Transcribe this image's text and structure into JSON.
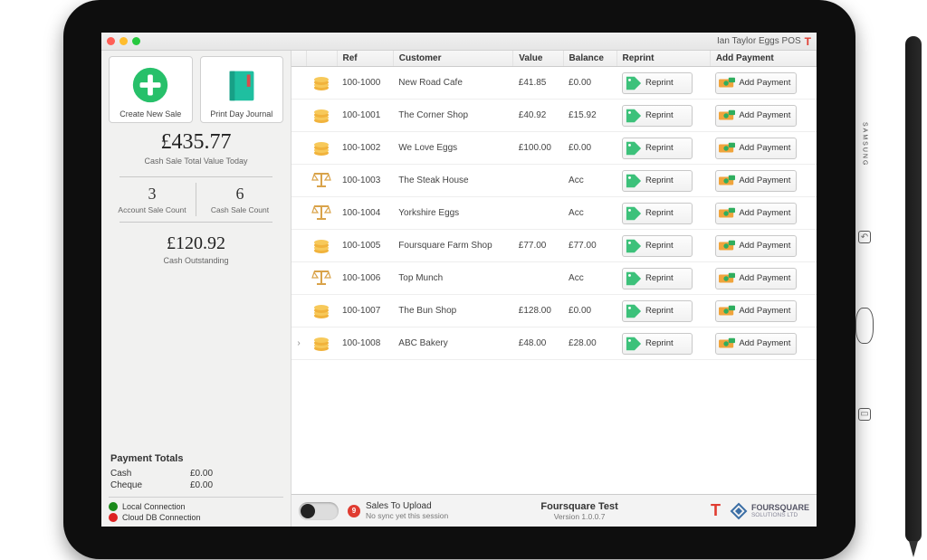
{
  "title": "Ian Taylor Eggs POS",
  "actions": {
    "new_sale": "Create New Sale",
    "print_journal": "Print Day Journal"
  },
  "stats": {
    "cash_total_value": "£435.77",
    "cash_total_label": "Cash Sale Total Value Today",
    "account_sale_count": "3",
    "account_sale_label": "Account Sale Count",
    "cash_sale_count": "6",
    "cash_sale_label": "Cash Sale Count",
    "cash_outstanding": "£120.92",
    "cash_outstanding_label": "Cash Outstanding"
  },
  "payment_totals": {
    "heading": "Payment Totals",
    "cash_label": "Cash",
    "cash_value": "£0.00",
    "cheque_label": "Cheque",
    "cheque_value": "£0.00"
  },
  "connections": {
    "local": "Local Connection",
    "cloud": "Cloud DB Connection"
  },
  "columns": {
    "ref": "Ref",
    "customer": "Customer",
    "value": "Value",
    "balance": "Balance",
    "reprint": "Reprint",
    "add_payment": "Add Payment"
  },
  "button_labels": {
    "reprint": "Reprint",
    "add_payment": "Add Payment"
  },
  "rows": [
    {
      "type": "cash",
      "ref": "100-1000",
      "customer": "New Road Cafe",
      "value": "£41.85",
      "balance": "£0.00",
      "expandable": false
    },
    {
      "type": "cash",
      "ref": "100-1001",
      "customer": "The Corner Shop",
      "value": "£40.92",
      "balance": "£15.92",
      "expandable": false
    },
    {
      "type": "cash",
      "ref": "100-1002",
      "customer": "We Love Eggs",
      "value": "£100.00",
      "balance": "£0.00",
      "expandable": false
    },
    {
      "type": "acc",
      "ref": "100-1003",
      "customer": "The Steak House",
      "value": "",
      "balance": "Acc",
      "expandable": false
    },
    {
      "type": "acc",
      "ref": "100-1004",
      "customer": "Yorkshire Eggs",
      "value": "",
      "balance": "Acc",
      "expandable": false
    },
    {
      "type": "cash",
      "ref": "100-1005",
      "customer": "Foursquare Farm Shop",
      "value": "£77.00",
      "balance": "£77.00",
      "expandable": false
    },
    {
      "type": "acc",
      "ref": "100-1006",
      "customer": "Top Munch",
      "value": "",
      "balance": "Acc",
      "expandable": false
    },
    {
      "type": "cash",
      "ref": "100-1007",
      "customer": "The Bun Shop",
      "value": "£128.00",
      "balance": "£0.00",
      "expandable": false
    },
    {
      "type": "cash",
      "ref": "100-1008",
      "customer": "ABC Bakery",
      "value": "£48.00",
      "balance": "£28.00",
      "expandable": true
    }
  ],
  "status": {
    "upload_count": "9",
    "upload_label": "Sales To Upload",
    "upload_sub": "No sync yet this session",
    "company": "Foursquare Test",
    "version": "Version 1.0.0.7",
    "brand": "FOURSQUARE",
    "brand_sub": "SOLUTIONS LTD"
  }
}
